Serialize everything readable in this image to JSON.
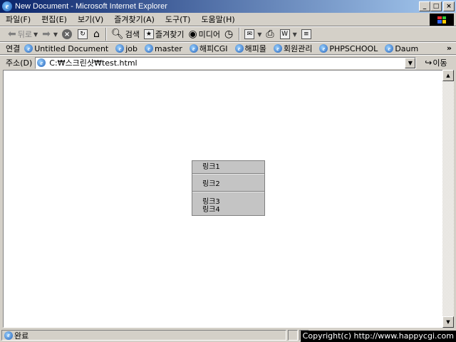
{
  "window": {
    "title": "New Document - Microsoft Internet Explorer",
    "minimize": "_",
    "maximize": "□",
    "close": "×"
  },
  "menubar": {
    "items": [
      "파일(F)",
      "편집(E)",
      "보기(V)",
      "즐겨찾기(A)",
      "도구(T)",
      "도움말(H)"
    ]
  },
  "toolbar": {
    "back_label": "뒤로",
    "search_label": "검색",
    "favorites_label": "즐겨찾기",
    "media_label": "미디어"
  },
  "links": {
    "label": "연결",
    "items": [
      "Untitled Document",
      "job",
      "master",
      "해피CGI",
      "해피몰",
      "회원관리",
      "PHPSCHOOL",
      "Daum"
    ],
    "more": "»"
  },
  "address": {
    "label": "주소(D)",
    "value": "C:₩스크린샷₩test.html",
    "go_label": "이동"
  },
  "popup_menu": {
    "items": [
      "링크1",
      "링크2",
      "링크3",
      "링크4"
    ]
  },
  "status": {
    "text": "완료",
    "copyright": "Copyright(c) http://www.happycgi.com"
  }
}
